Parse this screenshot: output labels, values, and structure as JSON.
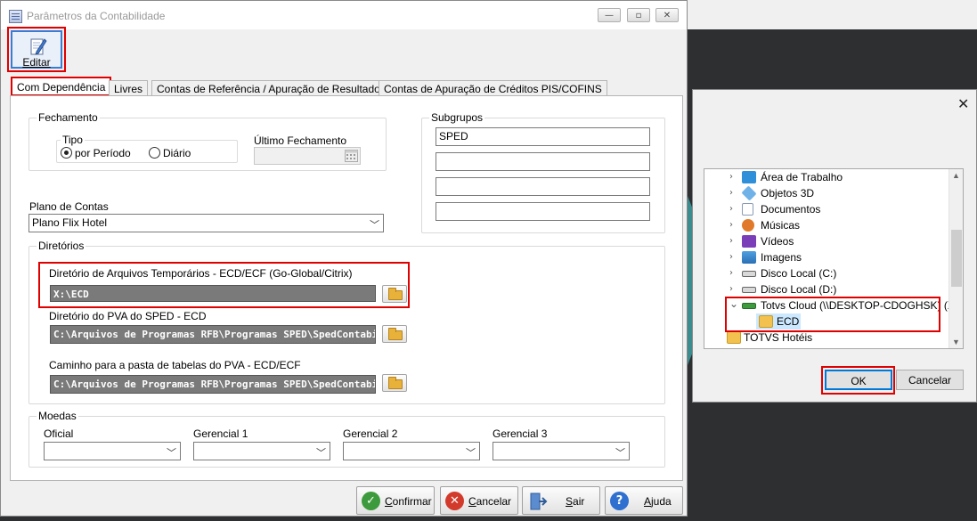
{
  "window": {
    "title": "Parâmetros da Contabilidade",
    "controls": {
      "minimize": "—",
      "maximize": "▫",
      "close": "✕"
    }
  },
  "toolbar": {
    "edit_label": "Editar"
  },
  "tabs": [
    {
      "label": "Com Dependência",
      "active": true
    },
    {
      "label": "Livres",
      "active": false
    },
    {
      "label": "Contas de Referência / Apuração de Resultados",
      "active": false
    },
    {
      "label": "Contas de Apuração de Créditos PIS/COFINS",
      "active": false
    }
  ],
  "fechamento": {
    "legend": "Fechamento",
    "tipo_label": "Tipo",
    "options": [
      {
        "label": "por Período",
        "selected": true
      },
      {
        "label": "Diário",
        "selected": false
      }
    ],
    "ultimo_label": "Último Fechamento",
    "ultimo_value": ""
  },
  "subgrupos": {
    "legend": "Subgrupos",
    "values": [
      "SPED",
      "",
      "",
      ""
    ]
  },
  "plano": {
    "label": "Plano de Contas",
    "value": "Plano Flix Hotel"
  },
  "diretorios": {
    "legend": "Diretórios",
    "temp_label": "Diretório de Arquivos Temporários - ECD/ECF (Go-Global/Citrix)",
    "temp_value": "X:\\ECD",
    "pva_label": "Diretório do PVA do SPED - ECD",
    "pva_value": "C:\\Arquivos de Programas RFB\\Programas SPED\\SpedContabil",
    "tabelas_label": "Caminho para a pasta de tabelas do PVA - ECD/ECF",
    "tabelas_value": "C:\\Arquivos de Programas RFB\\Programas SPED\\SpedContabil"
  },
  "moedas": {
    "legend": "Moedas",
    "fields": [
      {
        "label": "Oficial",
        "value": ""
      },
      {
        "label": "Gerencial 1",
        "value": ""
      },
      {
        "label": "Gerencial 2",
        "value": ""
      },
      {
        "label": "Gerencial 3",
        "value": ""
      }
    ]
  },
  "buttons": {
    "confirm": "Confirmar",
    "cancel": "Cancelar",
    "exit": "Sair",
    "help": "Ajuda"
  },
  "dialog": {
    "close": "✕",
    "tree": [
      {
        "label": "Área de Trabalho",
        "icon": "desktop-icon",
        "expander": "›"
      },
      {
        "label": "Objetos 3D",
        "icon": "cube-icon",
        "expander": "›"
      },
      {
        "label": "Documentos",
        "icon": "documents-icon",
        "expander": "›"
      },
      {
        "label": "Músicas",
        "icon": "music-icon",
        "expander": "›"
      },
      {
        "label": "Vídeos",
        "icon": "video-icon",
        "expander": "›"
      },
      {
        "label": "Imagens",
        "icon": "images-icon",
        "expander": "›"
      },
      {
        "label": "Disco Local (C:)",
        "icon": "drive-icon",
        "expander": "›"
      },
      {
        "label": "Disco Local (D:)",
        "icon": "drive-icon",
        "expander": "›"
      },
      {
        "label": "Totvs Cloud (\\\\DESKTOP-CDOGHSK) (X:)",
        "icon": "network-drive-icon",
        "expander": "⌄"
      },
      {
        "label": "ECD",
        "icon": "folder-icon",
        "expander": ""
      },
      {
        "label": "TOTVS Hotéis",
        "icon": "folder-icon",
        "expander": ""
      }
    ],
    "ok": "OK",
    "cancel": "Cancelar"
  },
  "colors": {
    "highlight_red": "#e00000",
    "focus_blue": "#0078d7",
    "selected_row": "#cce8ff"
  }
}
